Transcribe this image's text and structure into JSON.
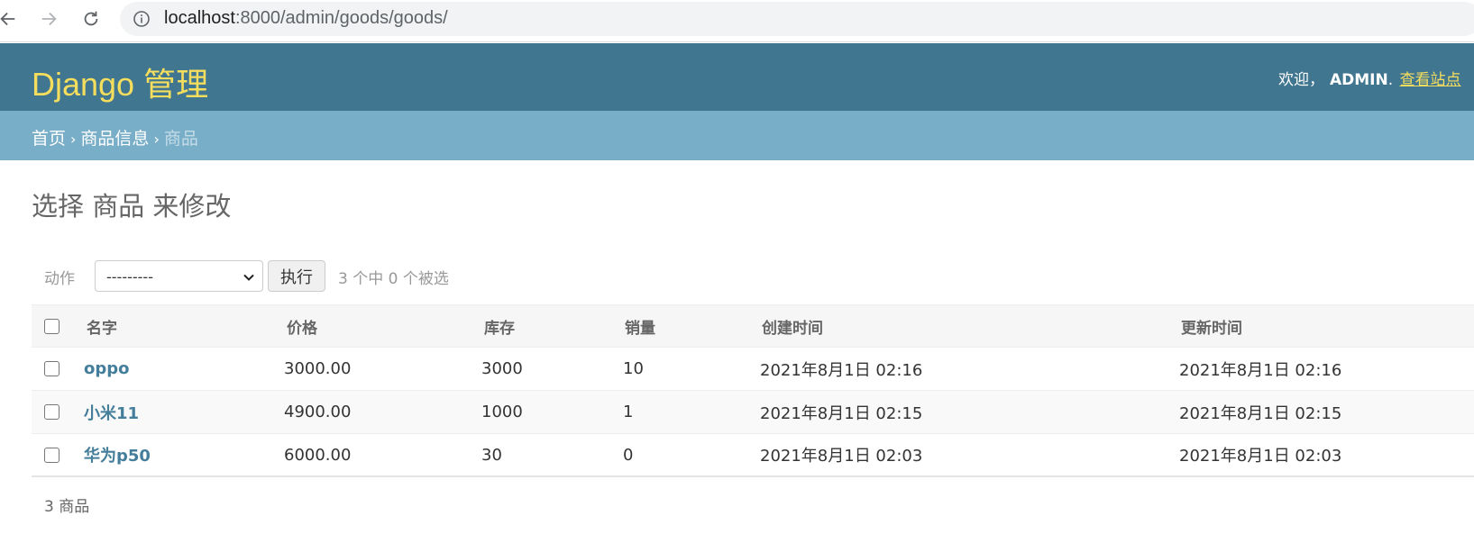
{
  "browser": {
    "url_host": "localhost",
    "url_rest": ":8000/admin/goods/goods/"
  },
  "header": {
    "branding": "Django 管理",
    "welcome": "欢迎，",
    "username": "ADMIN",
    "view_site": "查看站点"
  },
  "breadcrumbs": {
    "home": "首页",
    "app": "商品信息",
    "model": "商品"
  },
  "page": {
    "title": "选择 商品 来修改"
  },
  "actions": {
    "label": "动作",
    "selected_option": "---------",
    "go_label": "执行",
    "counter": "3 个中 0 个被选"
  },
  "table": {
    "columns": [
      "名字",
      "价格",
      "库存",
      "销量",
      "创建时间",
      "更新时间"
    ],
    "rows": [
      {
        "name": "oppo",
        "price": "3000.00",
        "stock": "3000",
        "sales": "10",
        "created": "2021年8月1日 02:16",
        "updated": "2021年8月1日 02:16"
      },
      {
        "name": "小米11",
        "price": "4900.00",
        "stock": "1000",
        "sales": "1",
        "created": "2021年8月1日 02:15",
        "updated": "2021年8月1日 02:15"
      },
      {
        "name": "华为p50",
        "price": "6000.00",
        "stock": "30",
        "sales": "0",
        "created": "2021年8月1日 02:03",
        "updated": "2021年8月1日 02:03"
      }
    ]
  },
  "paginator": "3 商品",
  "colors": {
    "header_bg": "#417690",
    "breadcrumb_bg": "#79aec8",
    "branding": "#f5dd5d",
    "link": "#447e9b"
  }
}
